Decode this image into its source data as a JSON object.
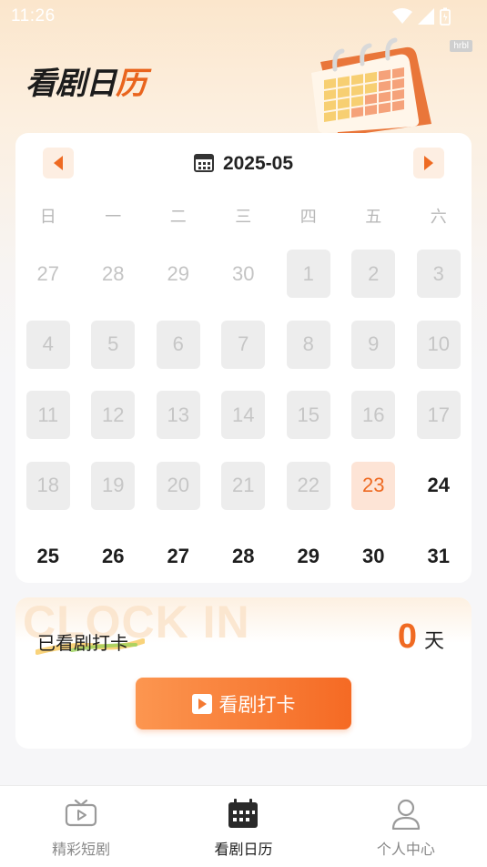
{
  "status_bar": {
    "time": "11:26"
  },
  "tag": "hrbl",
  "header": {
    "title_main": "看剧日",
    "title_accent": "历"
  },
  "calendar": {
    "month": "2025-05",
    "weekdays": [
      "日",
      "一",
      "二",
      "三",
      "四",
      "五",
      "六"
    ],
    "days": [
      {
        "label": "27",
        "state": "other"
      },
      {
        "label": "28",
        "state": "other"
      },
      {
        "label": "29",
        "state": "other"
      },
      {
        "label": "30",
        "state": "other"
      },
      {
        "label": "1",
        "state": "past"
      },
      {
        "label": "2",
        "state": "past"
      },
      {
        "label": "3",
        "state": "past"
      },
      {
        "label": "4",
        "state": "past"
      },
      {
        "label": "5",
        "state": "past"
      },
      {
        "label": "6",
        "state": "past"
      },
      {
        "label": "7",
        "state": "past"
      },
      {
        "label": "8",
        "state": "past"
      },
      {
        "label": "9",
        "state": "past"
      },
      {
        "label": "10",
        "state": "past"
      },
      {
        "label": "11",
        "state": "past"
      },
      {
        "label": "12",
        "state": "past"
      },
      {
        "label": "13",
        "state": "past"
      },
      {
        "label": "14",
        "state": "past"
      },
      {
        "label": "15",
        "state": "past"
      },
      {
        "label": "16",
        "state": "past"
      },
      {
        "label": "17",
        "state": "past"
      },
      {
        "label": "18",
        "state": "past"
      },
      {
        "label": "19",
        "state": "past"
      },
      {
        "label": "20",
        "state": "past"
      },
      {
        "label": "21",
        "state": "past"
      },
      {
        "label": "22",
        "state": "past"
      },
      {
        "label": "23",
        "state": "today"
      },
      {
        "label": "24",
        "state": "future"
      },
      {
        "label": "25",
        "state": "future"
      },
      {
        "label": "26",
        "state": "future"
      },
      {
        "label": "27",
        "state": "future"
      },
      {
        "label": "28",
        "state": "future"
      },
      {
        "label": "29",
        "state": "future"
      },
      {
        "label": "30",
        "state": "future"
      },
      {
        "label": "31",
        "state": "future"
      }
    ]
  },
  "checkin": {
    "watermark": "CLOCK IN",
    "label": "已看剧打卡",
    "count": "0",
    "unit": "天",
    "button_label": "看剧打卡"
  },
  "tabbar": {
    "tabs": [
      {
        "label": "精彩短剧",
        "icon": "tv-icon",
        "active": false
      },
      {
        "label": "看剧日历",
        "icon": "calendar-icon",
        "active": true
      },
      {
        "label": "个人中心",
        "icon": "person-icon",
        "active": false
      }
    ]
  },
  "colors": {
    "accent": "#f06a22",
    "today_bg": "#fde4d6",
    "past_bg": "#ededed",
    "button_gradient": [
      "#fc9650",
      "#f56a24"
    ]
  }
}
